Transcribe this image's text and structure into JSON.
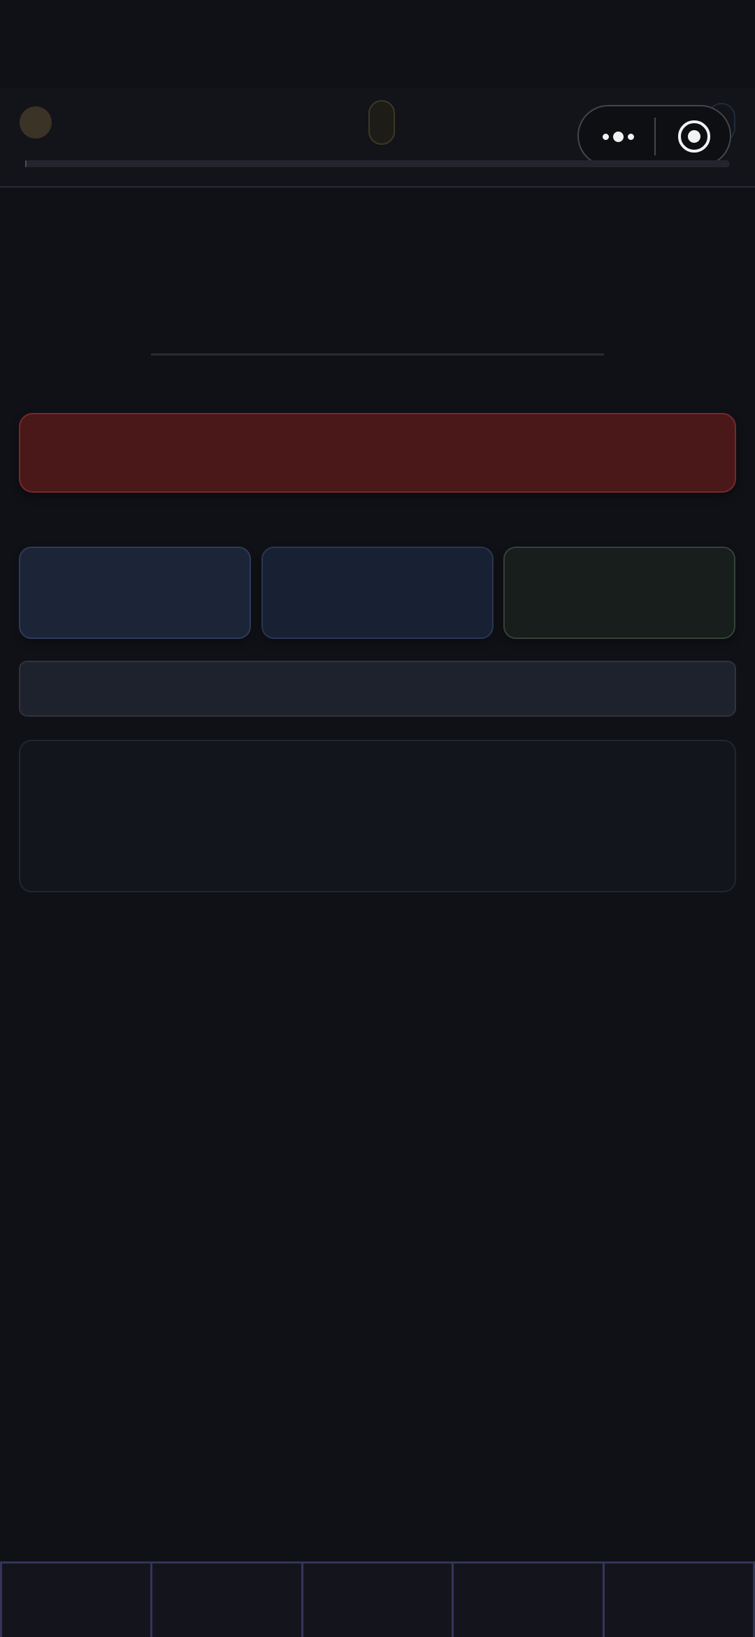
{
  "header": {
    "progress": 0.0
  },
  "mini_program_capsule": {
    "menu_icon": "more-dots-icon",
    "close_icon": "close-target-icon"
  },
  "colors": {
    "background": "#101116",
    "primary_action": "#4a1819",
    "card_blue": "#1c2537",
    "card_navy": "#182133",
    "card_green": "#181e1b",
    "nav_border": "#34345a"
  },
  "bottom_nav": {
    "items": [
      {
        "label": ""
      },
      {
        "label": ""
      },
      {
        "label": ""
      },
      {
        "label": ""
      },
      {
        "label": ""
      }
    ]
  }
}
